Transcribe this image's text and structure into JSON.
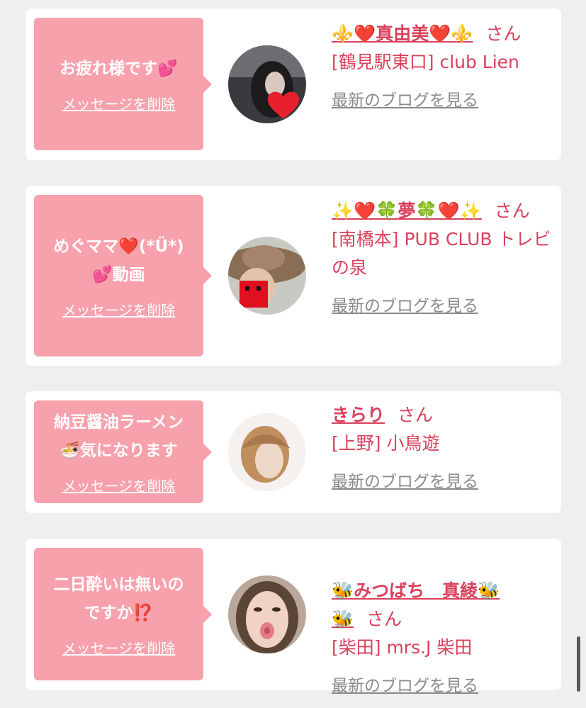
{
  "cards": [
    {
      "message": "お疲れ様です💕",
      "delete_label": "メッセージを削除",
      "name": "⚜️❤️真由美❤️⚜️",
      "honorific": "さん",
      "shop": "[鶴見駅東口] club Lien",
      "blog_label": "最新のブログを見る"
    },
    {
      "message": "めぐママ❤️(*Ü*)\n💕動画",
      "delete_label": "メッセージを削除",
      "name": "✨❤️🍀夢🍀❤️✨",
      "honorific": "さん",
      "shop": "[南橋本] PUB CLUB トレビの泉",
      "blog_label": "最新のブログを見る"
    },
    {
      "message": "納豆醤油ラーメン\n🍜気になります",
      "delete_label": "メッセージを削除",
      "name": "きらり",
      "honorific": "さん",
      "shop": "[上野] 小鳥遊",
      "blog_label": "最新のブログを見る"
    },
    {
      "message": "二日酔いは無いの\nですか⁉️",
      "delete_label": "メッセージを削除",
      "name": "🐝みつばち　真綾🐝\n🐝",
      "honorific": "さん",
      "shop": "[柴田] mrs.J 柴田",
      "blog_label": "最新のブログを見る"
    }
  ]
}
